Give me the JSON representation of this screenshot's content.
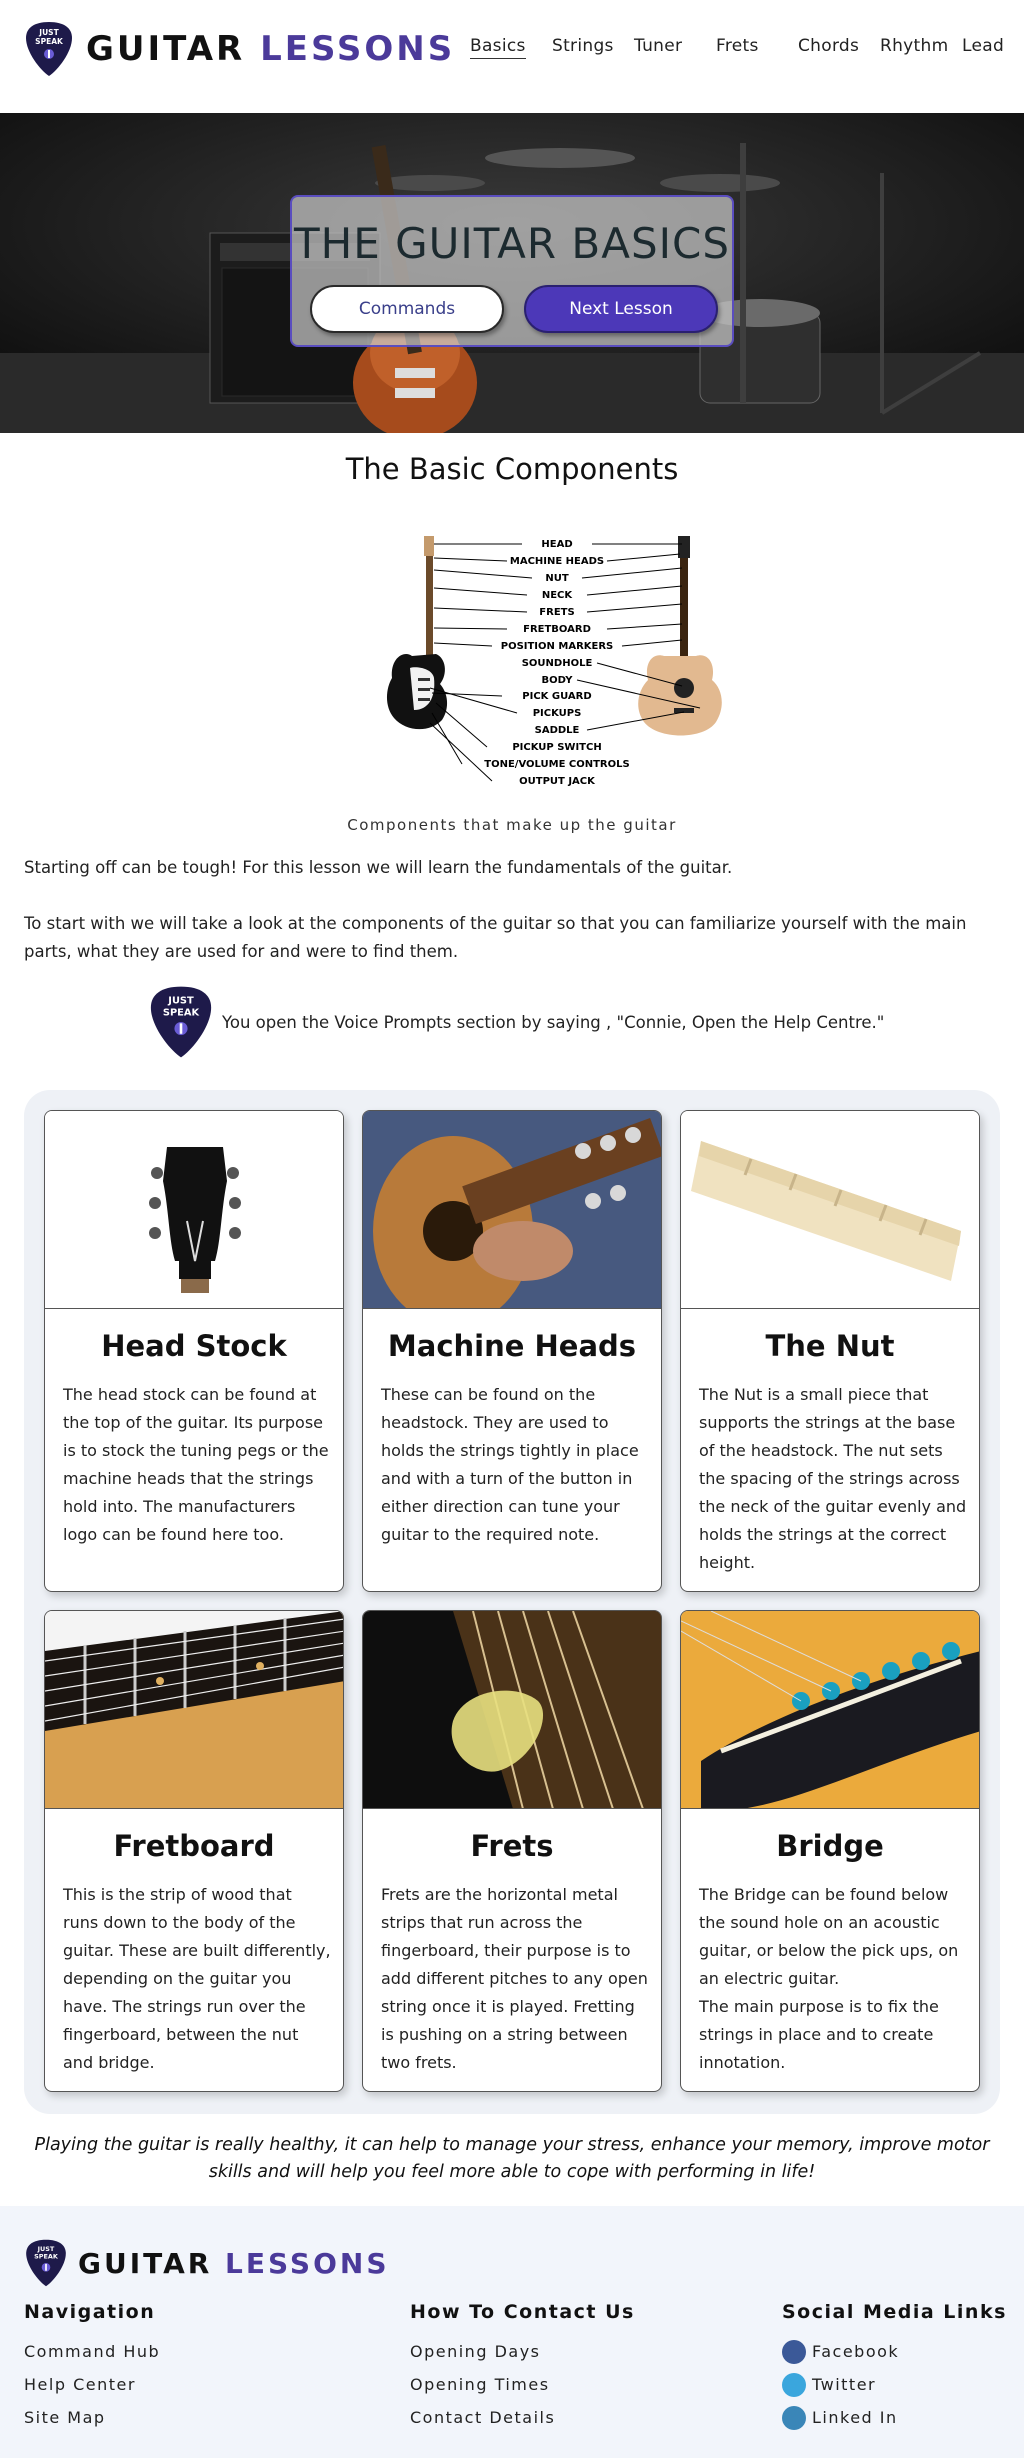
{
  "header": {
    "logo_badge_line1": "JUST",
    "logo_badge_line2": "SPEAK",
    "logo_word1": "GUITAR",
    "logo_word2": "LESSONS",
    "nav": [
      {
        "label": "Basics"
      },
      {
        "label": "Strings"
      },
      {
        "label": "Tuner"
      },
      {
        "label": "Frets"
      },
      {
        "label": "Chords"
      },
      {
        "label": "Rhythm"
      },
      {
        "label": "Lead"
      }
    ]
  },
  "hero": {
    "title": "THE GUITAR BASICS",
    "commands_label": "Commands",
    "next_label": "Next Lesson"
  },
  "components": {
    "title": "The Basic Components",
    "diagram_labels": [
      "HEAD",
      "MACHINE HEADS",
      "NUT",
      "NECK",
      "FRETS",
      "FRETBOARD",
      "POSITION MARKERS",
      "SOUNDHOLE",
      "BODY",
      "PICK GUARD",
      "PICKUPS",
      "SADDLE",
      "PICKUP SWITCH",
      "TONE/VOLUME CONTROLS",
      "OUTPUT JACK"
    ],
    "caption": "Components that make up the guitar",
    "para1": "Starting off can be tough! For this lesson we will learn the fundamentals of the guitar.",
    "para2": "To start with we will take a look at the components of the guitar so that you can familiarize yourself with the main parts, what they are used for and were to find them.",
    "voice_prompt": "You open the Voice Prompts section by saying , \"Connie, Open the Help Centre.\""
  },
  "cards": [
    {
      "title": "Head Stock",
      "text": "The head stock can be found at the top of the guitar. Its purpose is to stock the tuning pegs or the machine heads that the strings hold into. The manufacturers logo can be found here too."
    },
    {
      "title": "Machine Heads",
      "text": "These can be found on the headstock. They are used to holds the strings tightly in place and with a turn of the button in either direction can tune your guitar to the required note."
    },
    {
      "title": "The Nut",
      "text": "The Nut is a small piece that supports the strings at the base of the headstock. The nut sets the spacing of the strings across the neck of the guitar evenly and holds the strings at the correct height."
    },
    {
      "title": "Fretboard",
      "text": "This is the strip of wood that runs down to the body of the guitar. These are built differently, depending on the guitar you have. The strings run over the fingerboard, between the nut and bridge."
    },
    {
      "title": "Frets",
      "text": "Frets are the horizontal metal strips that run across the fingerboard, their purpose is to add different pitches to any open string once it is played. Fretting is pushing on a string between two frets."
    },
    {
      "title": "Bridge",
      "text": "The Bridge can be found below the sound hole on an acoustic guitar, or below the pick ups, on an electric guitar.\nThe main purpose is to fix the strings in place and to create innotation."
    }
  ],
  "quote": "Playing the guitar is really healthy, it can help to manage your stress, enhance your memory, improve motor skills and will help you feel more able to cope with performing in life!",
  "footer": {
    "nav_title": "Navigation",
    "nav_links": [
      "Command Hub",
      "Help Center",
      "Site Map"
    ],
    "contact_title": "How To Contact Us",
    "contact_links": [
      "Opening Days",
      "Opening Times",
      "Contact Details"
    ],
    "social_title": "Social Media Links",
    "social_links": [
      "Facebook",
      "Twitter",
      "Linked In"
    ],
    "social_colors": [
      "#3b5998",
      "#3aa6dd",
      "#3a86b8"
    ]
  }
}
